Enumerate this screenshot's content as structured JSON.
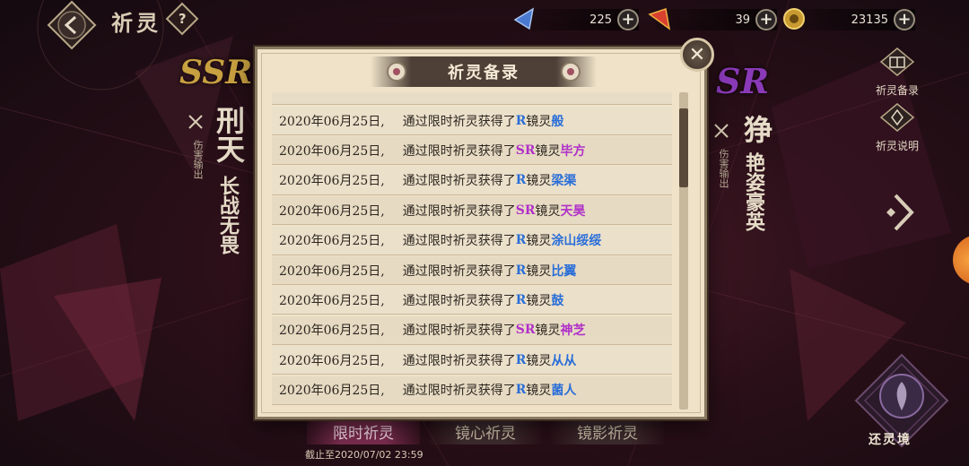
{
  "header": {
    "title": "祈灵",
    "help_label": "?"
  },
  "currencies": [
    {
      "name": "blue-crystal",
      "value": "225",
      "color": "#4a7ad0"
    },
    {
      "name": "red-crystal",
      "value": "39",
      "color": "#d84030"
    },
    {
      "name": "gold-coin",
      "value": "23135",
      "color": "#d8b040"
    }
  ],
  "left_card": {
    "rarity": "SSR",
    "name": "刑天",
    "subtitle": "长战无畏",
    "role": "伤害输出"
  },
  "right_card": {
    "rarity": "SR",
    "name": "狰",
    "subtitle": "艳姿豪英",
    "role": "伤害输出"
  },
  "side_buttons": [
    {
      "label": "祈灵备录",
      "icon": "book-icon"
    },
    {
      "label": "祈灵说明",
      "icon": "info-icon"
    }
  ],
  "return_label": "还灵境",
  "bottom_tabs": [
    {
      "label": "限时祈灵",
      "active": true
    },
    {
      "label": "镜心祈灵",
      "active": false
    },
    {
      "label": "镜影祈灵",
      "active": false
    }
  ],
  "deadline": "截止至2020/07/02 23:59",
  "modal": {
    "title": "祈灵备录",
    "close": "✕",
    "rows": [
      {
        "date": "2020年06月25日,",
        "msg": "通过限时祈灵获得了",
        "rarity": "R",
        "type": "镜灵",
        "name": "般"
      },
      {
        "date": "2020年06月25日,",
        "msg": "通过限时祈灵获得了",
        "rarity": "SR",
        "type": "镜灵",
        "name": "毕方"
      },
      {
        "date": "2020年06月25日,",
        "msg": "通过限时祈灵获得了",
        "rarity": "R",
        "type": "镜灵",
        "name": "梁渠"
      },
      {
        "date": "2020年06月25日,",
        "msg": "通过限时祈灵获得了",
        "rarity": "SR",
        "type": "镜灵",
        "name": "天昊"
      },
      {
        "date": "2020年06月25日,",
        "msg": "通过限时祈灵获得了",
        "rarity": "R",
        "type": "镜灵",
        "name": "涂山绥绥"
      },
      {
        "date": "2020年06月25日,",
        "msg": "通过限时祈灵获得了",
        "rarity": "R",
        "type": "镜灵",
        "name": "比翼"
      },
      {
        "date": "2020年06月25日,",
        "msg": "通过限时祈灵获得了",
        "rarity": "R",
        "type": "镜灵",
        "name": "鼓"
      },
      {
        "date": "2020年06月25日,",
        "msg": "通过限时祈灵获得了",
        "rarity": "SR",
        "type": "镜灵",
        "name": "神芝"
      },
      {
        "date": "2020年06月25日,",
        "msg": "通过限时祈灵获得了",
        "rarity": "R",
        "type": "镜灵",
        "name": "从从"
      },
      {
        "date": "2020年06月25日,",
        "msg": "通过限时祈灵获得了",
        "rarity": "R",
        "type": "镜灵",
        "name": "菌人"
      }
    ]
  }
}
